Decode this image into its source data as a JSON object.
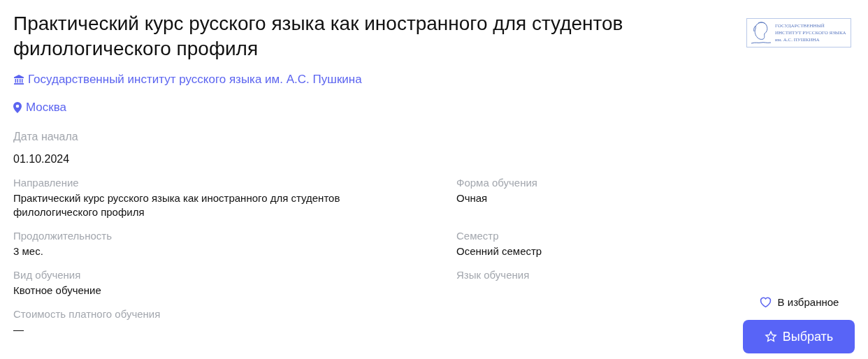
{
  "title": "Практический курс русского языка как иностранного для студентов филологического профиля",
  "institution": "Государственный институт русского языка им. А.С. Пушкина",
  "city": "Москва",
  "logo": {
    "lines": [
      "ГОСУДАРСТВЕННЫЙ",
      "ИНСТИТУТ РУССКОГО ЯЗЫКА",
      "им. А.С. ПУШКИНА"
    ]
  },
  "start": {
    "label": "Дата начала",
    "value": "01.10.2024"
  },
  "fields": [
    {
      "label": "Направление",
      "value": "Практический курс русского языка как иностранного для студентов филологического профиля"
    },
    {
      "label": "Форма обучения",
      "value": "Очная"
    },
    {
      "label": "Продолжительность",
      "value": "3 мес."
    },
    {
      "label": "Семестр",
      "value": "Осенний семестр"
    },
    {
      "label": "Вид обучения",
      "value": "Квотное обучение"
    },
    {
      "label": "Язык обучения"
    },
    {
      "label": "Стоимость платного обучения",
      "value": "—"
    }
  ],
  "favorite": {
    "label": "В избранное",
    "selected": false
  },
  "choose_button": "Выбрать"
}
